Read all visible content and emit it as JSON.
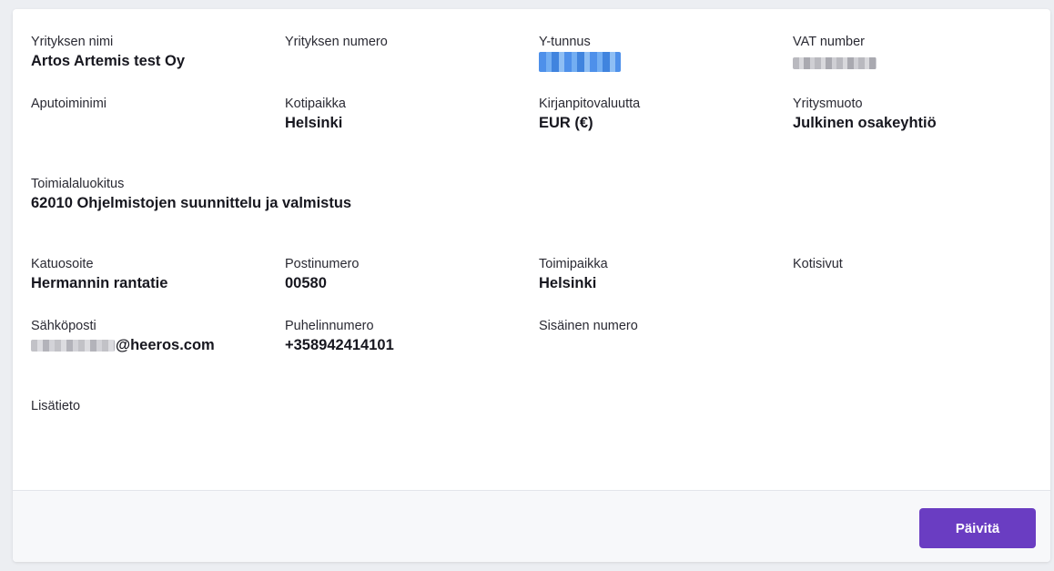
{
  "company": {
    "name": {
      "label": "Yrityksen nimi",
      "value": "Artos Artemis test Oy"
    },
    "number": {
      "label": "Yrityksen numero",
      "value": ""
    },
    "business_id": {
      "label": "Y-tunnus"
    },
    "vat": {
      "label": "VAT number"
    },
    "aux_name": {
      "label": "Aputoiminimi",
      "value": ""
    },
    "domicile": {
      "label": "Kotipaikka",
      "value": "Helsinki"
    },
    "currency": {
      "label": "Kirjanpitovaluutta",
      "value": "EUR (€)"
    },
    "company_form": {
      "label": "Yritysmuoto",
      "value": "Julkinen osakeyhtiö"
    },
    "industry": {
      "label": "Toimialaluokitus",
      "value": "62010 Ohjelmistojen suunnittelu ja valmistus"
    }
  },
  "address": {
    "street": {
      "label": "Katuosoite",
      "value": "Hermannin rantatie"
    },
    "postal_code": {
      "label": "Postinumero",
      "value": "00580"
    },
    "city": {
      "label": "Toimipaikka",
      "value": "Helsinki"
    },
    "website": {
      "label": "Kotisivut",
      "value": ""
    },
    "email": {
      "label": "Sähköposti",
      "value_suffix": "@heeros.com"
    },
    "phone": {
      "label": "Puhelinnumero",
      "value": "+358942414101"
    },
    "internal_number": {
      "label": "Sisäinen numero",
      "value": ""
    },
    "extra_info": {
      "label": "Lisätieto",
      "value": ""
    }
  },
  "footer": {
    "update_label": "Päivitä"
  },
  "colors": {
    "accent": "#6a3dc2",
    "background": "#eceef2",
    "card": "#ffffff",
    "footer": "#f7f8fa"
  }
}
